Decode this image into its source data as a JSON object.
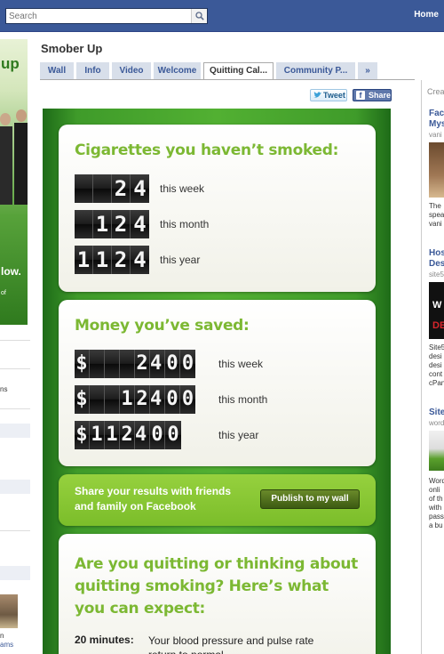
{
  "topbar": {
    "search_placeholder": "Search",
    "home_label": "Home"
  },
  "left": {
    "profile_logo": "up",
    "profile_slogan": "low.",
    "profile_of": "of",
    "ns": "ns",
    "n": "n",
    "ams": "ams"
  },
  "page": {
    "title": "Smober Up",
    "tabs": [
      {
        "label": "Wall"
      },
      {
        "label": "Info"
      },
      {
        "label": "Video"
      },
      {
        "label": "Welcome"
      },
      {
        "label": "Quitting Cal..."
      },
      {
        "label": "Community P..."
      },
      {
        "label": "»"
      }
    ],
    "active_tab": "Quitting Cal...",
    "tweet_label": "Tweet",
    "share_label": "Share"
  },
  "app": {
    "cigarettes": {
      "title": "Cigarettes you haven’t smoked:",
      "rows": [
        {
          "digits": [
            "",
            "",
            "2",
            "4"
          ],
          "label": "this week",
          "value": 24
        },
        {
          "digits": [
            "",
            "1",
            "2",
            "4"
          ],
          "label": "this month",
          "value": 124
        },
        {
          "digits": [
            "1",
            "1",
            "2",
            "4"
          ],
          "label": "this year",
          "value": 1124
        }
      ]
    },
    "money": {
      "title": "Money you’ve saved:",
      "rows": [
        {
          "digits": [
            "$",
            "",
            "",
            "",
            "2",
            "4.",
            "0",
            "0"
          ],
          "label": "this week",
          "value": "$24.00"
        },
        {
          "digits": [
            "$",
            "",
            "",
            "1",
            "2",
            "4.",
            "0",
            "0"
          ],
          "label": "this month",
          "value": "$124.00"
        },
        {
          "digits": [
            "$",
            "1",
            "1",
            "2",
            "4.",
            "0",
            "0"
          ],
          "label": "this year",
          "value": "$1124.00"
        }
      ]
    },
    "share": {
      "text": "Share your results with friends and family on Facebook",
      "button": "Publish to my wall"
    },
    "expect": {
      "title": "Are you quitting or thinking about quitting smoking? Here’s what you can expect:",
      "time": "20 minutes:",
      "description": "Your blood pressure and pulse rate return to normal"
    }
  },
  "right": {
    "header": "Crea",
    "ad1": {
      "title1": "Face",
      "title2": "Mys",
      "sub": "vani",
      "text": [
        "The",
        "spea",
        "vani"
      ]
    },
    "ad2": {
      "title1": "Hos",
      "title2": "Des",
      "sub": "site5",
      "text": [
        "Site5",
        "desi",
        "desi",
        "cont",
        "cPan"
      ]
    },
    "ad3": {
      "title1": "Site",
      "sub": "word",
      "text": [
        "Word",
        "onli",
        "of th",
        "with",
        "pass",
        "a bu"
      ]
    }
  },
  "colors": {
    "facebook_blue": "#3b5998",
    "app_green": "#52b032",
    "title_green": "#7cb833",
    "share_green": "#8cc83a"
  }
}
